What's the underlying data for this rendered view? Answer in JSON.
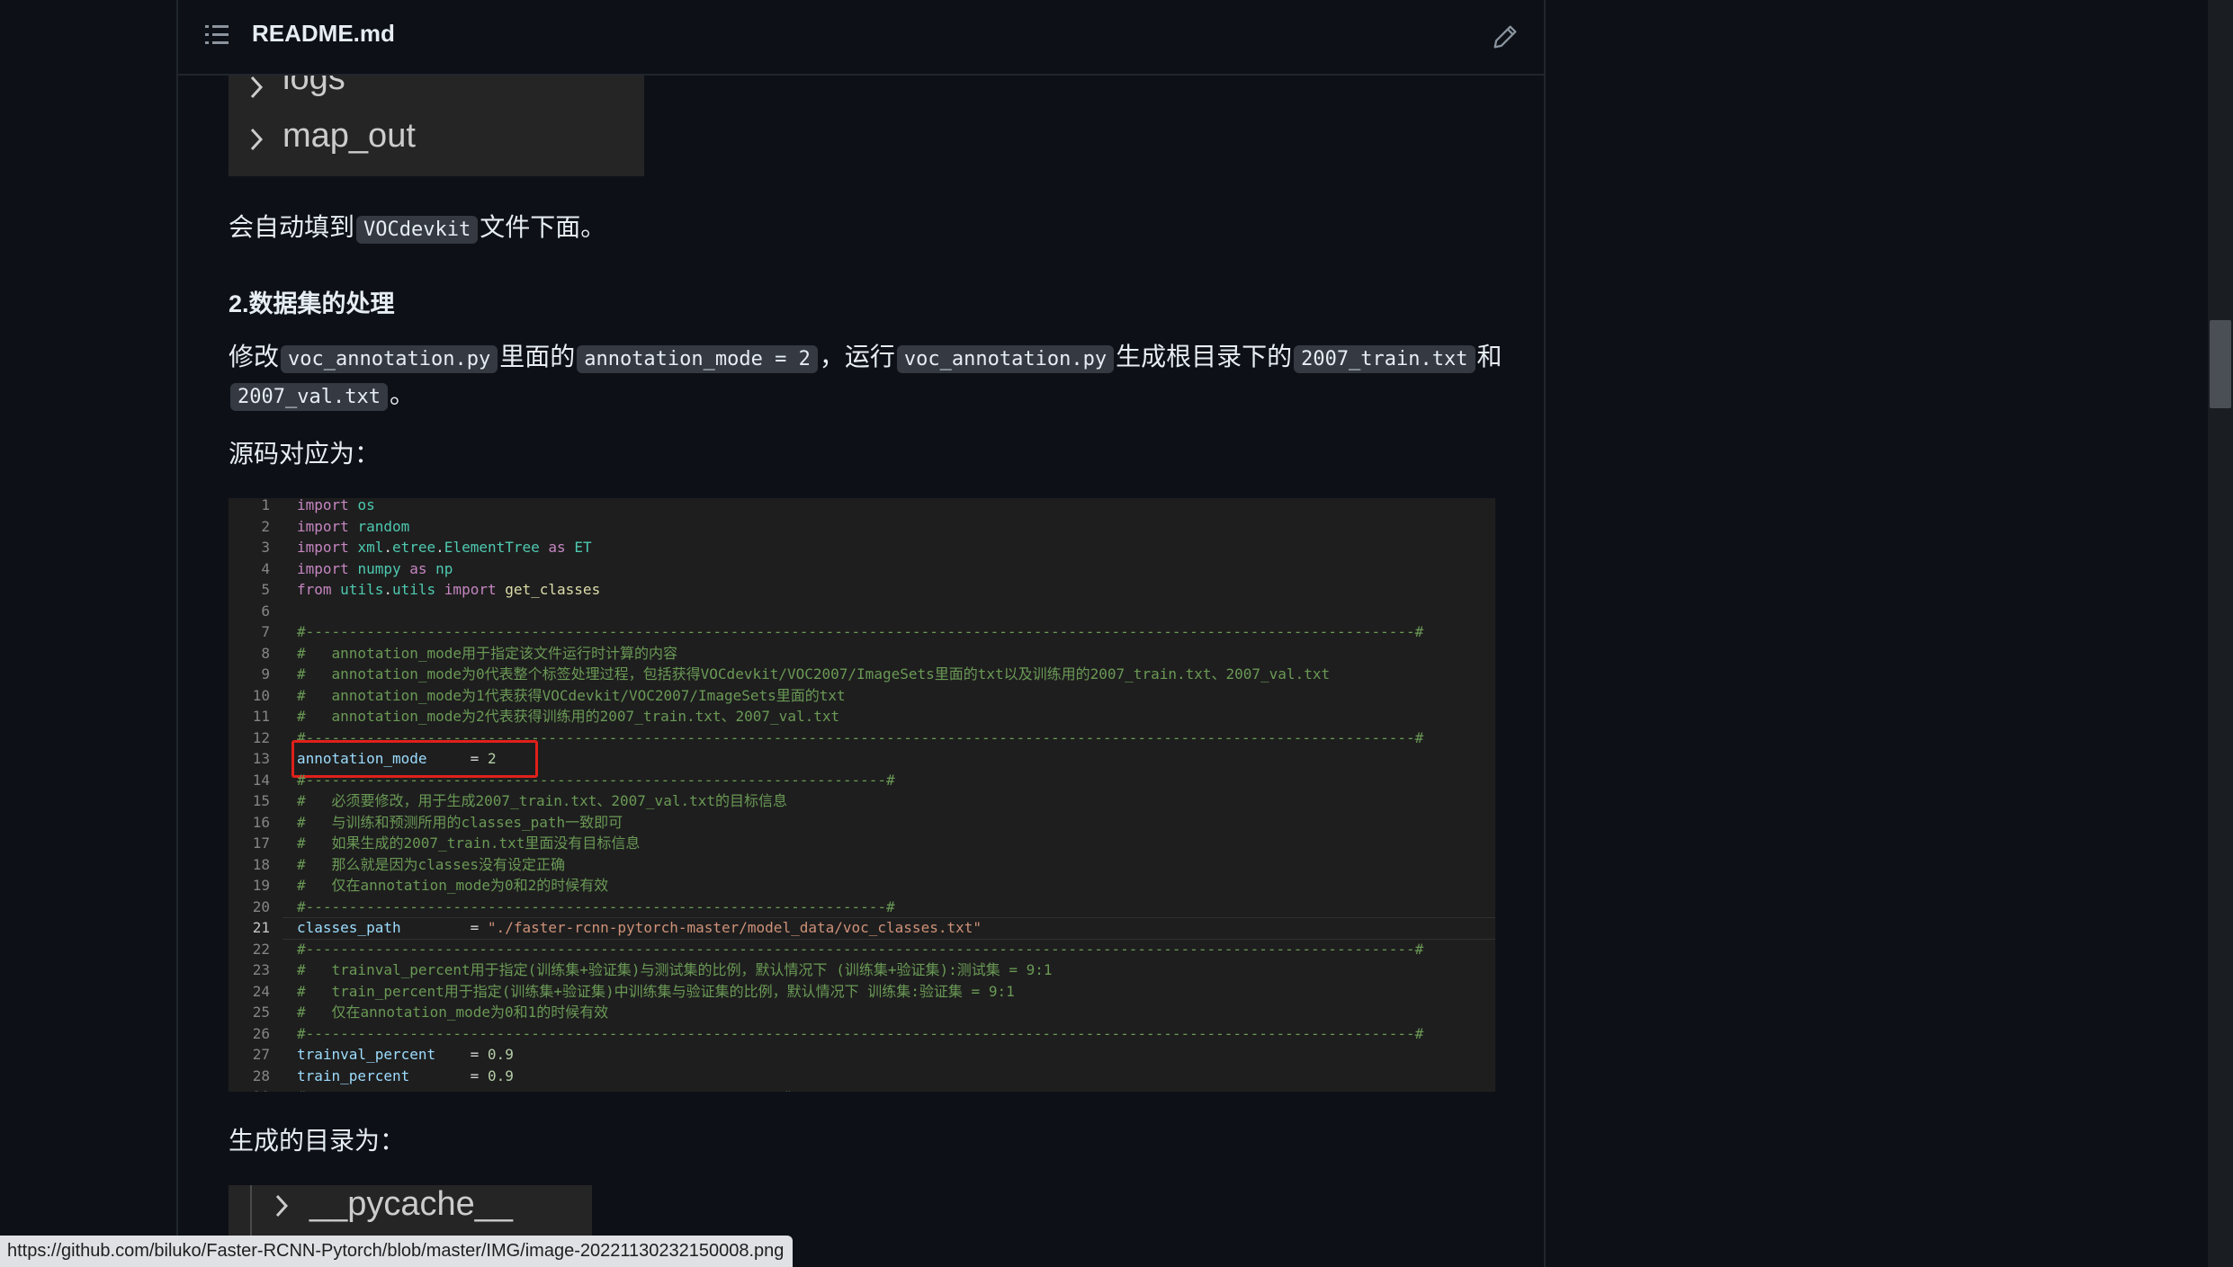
{
  "header": {
    "file_title": "README.md"
  },
  "folders_top": [
    "logs",
    "map_out"
  ],
  "folders_bottom": [
    "__pycache__"
  ],
  "p1": {
    "before": "会自动填到",
    "code": "VOCdevkit",
    "after": "文件下面。"
  },
  "heading2": "2.数据集的处理",
  "p2": {
    "t1": "修改",
    "c1": "voc_annotation.py",
    "t2": "里面的",
    "c2": "annotation_mode = 2",
    "t3": "，运行",
    "c3": "voc_annotation.py",
    "t4": "生成根目录下的",
    "c4": "2007_train.txt",
    "t5": "和",
    "c5": "2007_val.txt",
    "t6": "。"
  },
  "p3": "源码对应为：",
  "p4": "生成的目录为：",
  "code": {
    "active_line": 21,
    "highlight_line": 13,
    "lines": [
      {
        "n": "1",
        "t": [
          [
            "kw",
            "import"
          ],
          [
            "pl",
            " "
          ],
          [
            "mod",
            "os"
          ]
        ]
      },
      {
        "n": "2",
        "t": [
          [
            "kw",
            "import"
          ],
          [
            "pl",
            " "
          ],
          [
            "mod",
            "random"
          ]
        ]
      },
      {
        "n": "3",
        "t": [
          [
            "kw",
            "import"
          ],
          [
            "pl",
            " "
          ],
          [
            "mod",
            "xml"
          ],
          [
            "pl",
            "."
          ],
          [
            "mod",
            "etree"
          ],
          [
            "pl",
            "."
          ],
          [
            "mod",
            "ElementTree"
          ],
          [
            "pl",
            " "
          ],
          [
            "kw",
            "as"
          ],
          [
            "pl",
            " "
          ],
          [
            "mod",
            "ET"
          ]
        ]
      },
      {
        "n": "4",
        "t": [
          [
            "kw",
            "import"
          ],
          [
            "pl",
            " "
          ],
          [
            "mod",
            "numpy"
          ],
          [
            "pl",
            " "
          ],
          [
            "kw",
            "as"
          ],
          [
            "pl",
            " "
          ],
          [
            "mod",
            "np"
          ]
        ]
      },
      {
        "n": "5",
        "t": [
          [
            "kw",
            "from"
          ],
          [
            "pl",
            " "
          ],
          [
            "mod",
            "utils"
          ],
          [
            "pl",
            "."
          ],
          [
            "mod",
            "utils"
          ],
          [
            "pl",
            " "
          ],
          [
            "kw",
            "import"
          ],
          [
            "pl",
            " "
          ],
          [
            "fn",
            "get_classes"
          ]
        ]
      },
      {
        "n": "6",
        "t": []
      },
      {
        "n": "7",
        "t": [
          [
            "cm",
            "#--------------------------------------------------------------------------------------------------------------------------------#"
          ]
        ]
      },
      {
        "n": "8",
        "t": [
          [
            "cm",
            "#   annotation_mode用于指定该文件运行时计算的内容"
          ]
        ]
      },
      {
        "n": "9",
        "t": [
          [
            "cm",
            "#   annotation_mode为0代表整个标签处理过程，包括获得VOCdevkit/VOC2007/ImageSets里面的txt以及训练用的2007_train.txt、2007_val.txt"
          ]
        ]
      },
      {
        "n": "10",
        "t": [
          [
            "cm",
            "#   annotation_mode为1代表获得VOCdevkit/VOC2007/ImageSets里面的txt"
          ]
        ]
      },
      {
        "n": "11",
        "t": [
          [
            "cm",
            "#   annotation_mode为2代表获得训练用的2007_train.txt、2007_val.txt"
          ]
        ]
      },
      {
        "n": "12",
        "t": [
          [
            "cm",
            "#--------------------------------------------------------------------------------------------------------------------------------#"
          ]
        ]
      },
      {
        "n": "13",
        "t": [
          [
            "id",
            "annotation_mode"
          ],
          [
            "pl",
            "     = "
          ],
          [
            "nm",
            "2"
          ]
        ]
      },
      {
        "n": "14",
        "t": [
          [
            "cm",
            "#-------------------------------------------------------------------#"
          ]
        ]
      },
      {
        "n": "15",
        "t": [
          [
            "cm",
            "#   必须要修改，用于生成2007_train.txt、2007_val.txt的目标信息"
          ]
        ]
      },
      {
        "n": "16",
        "t": [
          [
            "cm",
            "#   与训练和预测所用的classes_path一致即可"
          ]
        ]
      },
      {
        "n": "17",
        "t": [
          [
            "cm",
            "#   如果生成的2007_train.txt里面没有目标信息"
          ]
        ]
      },
      {
        "n": "18",
        "t": [
          [
            "cm",
            "#   那么就是因为classes没有设定正确"
          ]
        ]
      },
      {
        "n": "19",
        "t": [
          [
            "cm",
            "#   仅在annotation_mode为0和2的时候有效"
          ]
        ]
      },
      {
        "n": "20",
        "t": [
          [
            "cm",
            "#-------------------------------------------------------------------#"
          ]
        ]
      },
      {
        "n": "21",
        "t": [
          [
            "id",
            "classes_path"
          ],
          [
            "pl",
            "        = "
          ],
          [
            "st",
            "\"./faster-rcnn-pytorch-master/model_data/voc_classes.txt\""
          ]
        ]
      },
      {
        "n": "22",
        "t": [
          [
            "cm",
            "#--------------------------------------------------------------------------------------------------------------------------------#"
          ]
        ]
      },
      {
        "n": "23",
        "t": [
          [
            "cm",
            "#   trainval_percent用于指定(训练集+验证集)与测试集的比例，默认情况下 (训练集+验证集):测试集 = 9:1"
          ]
        ]
      },
      {
        "n": "24",
        "t": [
          [
            "cm",
            "#   train_percent用于指定(训练集+验证集)中训练集与验证集的比例，默认情况下 训练集:验证集 = 9:1"
          ]
        ]
      },
      {
        "n": "25",
        "t": [
          [
            "cm",
            "#   仅在annotation_mode为0和1的时候有效"
          ]
        ]
      },
      {
        "n": "26",
        "t": [
          [
            "cm",
            "#--------------------------------------------------------------------------------------------------------------------------------#"
          ]
        ]
      },
      {
        "n": "27",
        "t": [
          [
            "id",
            "trainval_percent"
          ],
          [
            "pl",
            "    = "
          ],
          [
            "nm",
            "0.9"
          ]
        ]
      },
      {
        "n": "28",
        "t": [
          [
            "id",
            "train_percent"
          ],
          [
            "pl",
            "       = "
          ],
          [
            "nm",
            "0.9"
          ]
        ]
      },
      {
        "n": "29",
        "t": [
          [
            "cm",
            "#-------------------------------------------------------#"
          ]
        ]
      }
    ]
  },
  "status_url": "https://github.com/biluko/Faster-RCNN-Pytorch/blob/master/IMG/image-20221130232150008.png",
  "icons": [
    "list-icon",
    "pencil-icon",
    "chevron-right-icon"
  ]
}
